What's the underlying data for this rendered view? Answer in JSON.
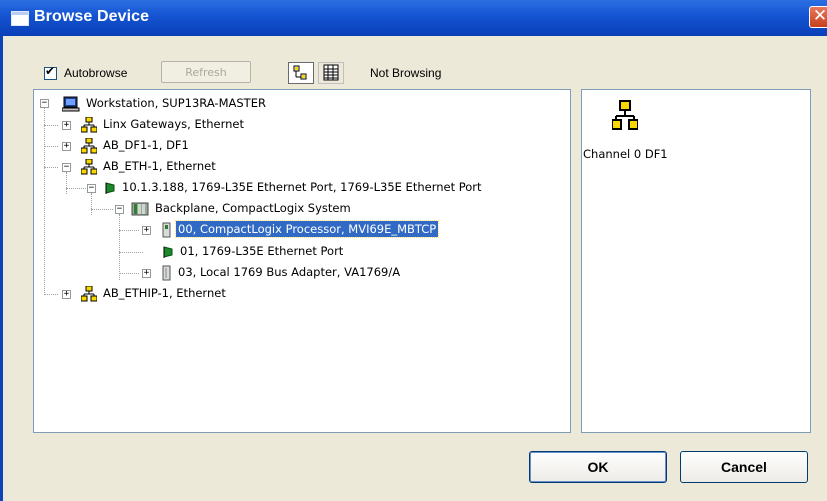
{
  "window": {
    "title": "Browse Device",
    "close_symbol": "✕"
  },
  "toolbar": {
    "autobrowse_label": "Autobrowse",
    "autobrowse_checked": true,
    "refresh_label": "Refresh",
    "status": "Not Browsing"
  },
  "tree": [
    {
      "label": "Workstation, SUP13RA-MASTER",
      "icon": "workstation-icon",
      "level": 0,
      "expander": "−"
    },
    {
      "label": "Linx Gateways, Ethernet",
      "icon": "network-icon",
      "level": 1,
      "expander": "+"
    },
    {
      "label": "AB_DF1-1, DF1",
      "icon": "network-icon",
      "level": 1,
      "expander": "+"
    },
    {
      "label": "AB_ETH-1, Ethernet",
      "icon": "network-icon",
      "level": 1,
      "expander": "−"
    },
    {
      "label": "10.1.3.188, 1769-L35E Ethernet Port, 1769-L35E Ethernet Port",
      "icon": "ethernet-port-icon",
      "level": 2,
      "expander": "−"
    },
    {
      "label": "Backplane, CompactLogix System",
      "icon": "backplane-icon",
      "level": 3,
      "expander": "−"
    },
    {
      "label": "00, CompactLogix Processor, MVI69E_MBTCP",
      "icon": "module-icon",
      "level": 4,
      "expander": "+",
      "selected": true
    },
    {
      "label": "01, 1769-L35E Ethernet Port",
      "icon": "ethernet-port-icon",
      "level": 4,
      "expander": ""
    },
    {
      "label": "03, Local 1769 Bus Adapter, VA1769/A",
      "icon": "module-icon",
      "level": 4,
      "expander": "+"
    },
    {
      "label": "AB_ETHIP-1, Ethernet",
      "icon": "network-icon",
      "level": 1,
      "expander": "+"
    }
  ],
  "right_pane": {
    "item_label": "Channel 0 DF1",
    "item_icon": "network-icon"
  },
  "buttons": {
    "ok_label": "OK",
    "cancel_label": "Cancel"
  },
  "colors": {
    "title_bar": "#0a3fb8",
    "selection": "#316ac5",
    "network_icon": "#f8d800"
  }
}
